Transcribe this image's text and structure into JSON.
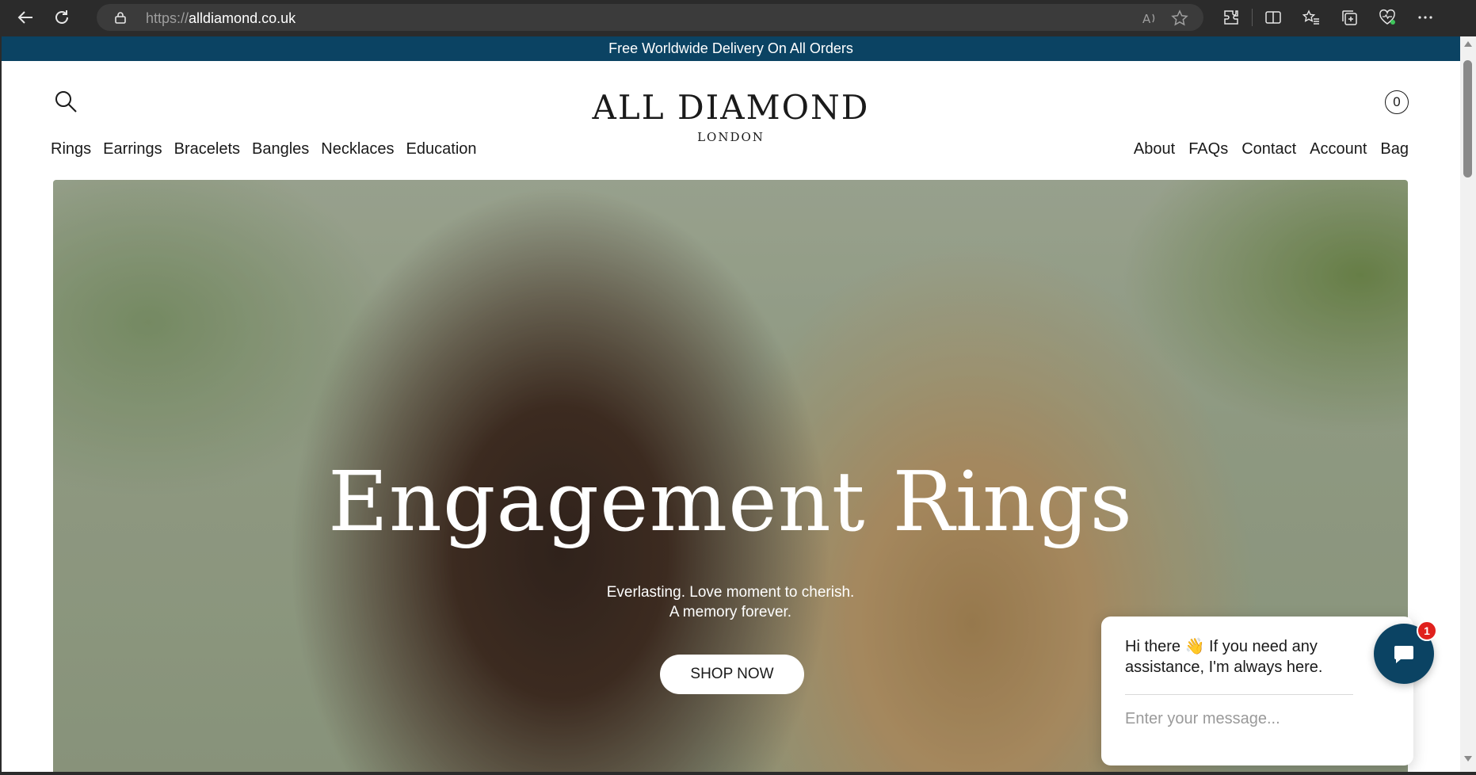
{
  "browser": {
    "url_prefix": "https://",
    "url_domain": "alldiamond.co.uk",
    "icons": [
      "back-icon",
      "reload-icon",
      "lock-icon",
      "read-aloud-icon",
      "favorite-star-icon",
      "extensions-icon",
      "split-screen-icon",
      "favorites-icon",
      "collections-icon",
      "browser-essentials-icon",
      "more-icon"
    ]
  },
  "promo": {
    "text": "Free Worldwide Delivery On All Orders",
    "bg": "#0b4363"
  },
  "header": {
    "logo_main": "ALL DIAMOND",
    "logo_sub": "LONDON",
    "bag_count": "0",
    "nav_left": [
      "Rings",
      "Earrings",
      "Bracelets",
      "Bangles",
      "Necklaces",
      "Education"
    ],
    "nav_right": [
      "About",
      "FAQs",
      "Contact",
      "Account",
      "Bag"
    ]
  },
  "hero": {
    "title": "Engagement Rings",
    "subtitle_line1": "Everlasting. Love moment to cherish.",
    "subtitle_line2": "A memory forever.",
    "cta": "SHOP NOW"
  },
  "chat": {
    "greeting_line1": "Hi there 👋 If you need any",
    "greeting_line2": "assistance, I'm always here.",
    "input_placeholder": "Enter your message...",
    "badge_count": "1",
    "accent": "#0b4363",
    "badge_color": "#e0211d"
  }
}
